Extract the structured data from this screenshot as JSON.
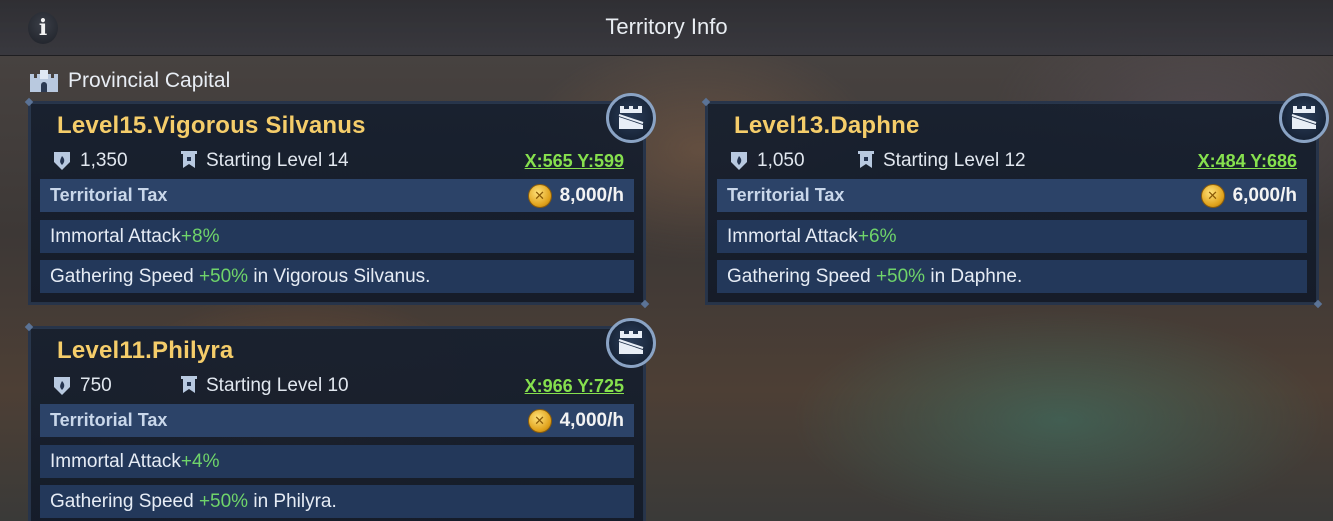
{
  "header": {
    "info_glyph": "i",
    "title": "Territory Info"
  },
  "section": {
    "label": "Provincial Capital"
  },
  "territories": [
    {
      "name": "Level15.Vigorous Silvanus",
      "power": "1,350",
      "starting_level": "Starting Level 14",
      "coords": "X:565 Y:599",
      "tax_label": "Territorial Tax",
      "tax_amount": "8,000/h",
      "buff1_text": "Immortal Attack",
      "buff1_value": "+8%",
      "buff2_prefix": "Gathering Speed ",
      "buff2_value": "+50%",
      "buff2_suffix": " in Vigorous Silvanus."
    },
    {
      "name": "Level13.Daphne",
      "power": "1,050",
      "starting_level": "Starting Level 12",
      "coords": "X:484 Y:686",
      "tax_label": "Territorial Tax",
      "tax_amount": "6,000/h",
      "buff1_text": "Immortal Attack",
      "buff1_value": "+6%",
      "buff2_prefix": "Gathering Speed ",
      "buff2_value": "+50%",
      "buff2_suffix": " in Daphne."
    },
    {
      "name": "Level11.Philyra",
      "power": "750",
      "starting_level": "Starting Level 10",
      "coords": "X:966 Y:725",
      "tax_label": "Territorial Tax",
      "tax_amount": "4,000/h",
      "buff1_text": "Immortal Attack",
      "buff1_value": "+4%",
      "buff2_prefix": "Gathering Speed ",
      "buff2_value": "+50%",
      "buff2_suffix": " in Philyra."
    }
  ],
  "icons": {
    "info": "info-icon",
    "section": "castle-icon",
    "power": "flame-shield-icon",
    "start": "banner-flag-icon",
    "badge": "fortress-badge-icon",
    "coin": "gold-coin-icon"
  },
  "colors": {
    "name_gold": "#f5cd6a",
    "coords_green": "#86e04e",
    "buff_green": "#6fd46a",
    "card_bg": "#16202f",
    "row_bg": "#23385a"
  }
}
